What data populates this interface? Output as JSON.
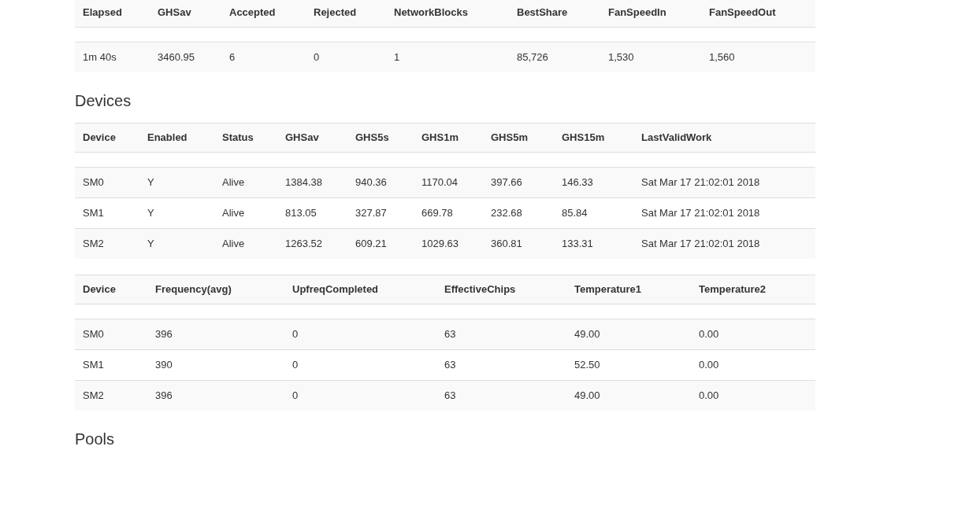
{
  "sections": [
    {
      "table": {
        "columns": [
          "Elapsed",
          "GHSav",
          "Accepted",
          "Rejected",
          "NetworkBlocks",
          "BestShare",
          "FanSpeedIn",
          "FanSpeedOut"
        ],
        "rows": [
          [
            "1m 40s",
            "3460.95",
            "6",
            "0",
            "1",
            "85,726",
            "1,530",
            "1,560"
          ]
        ]
      }
    },
    {
      "heading": "Devices",
      "table": {
        "columns": [
          "Device",
          "Enabled",
          "Status",
          "GHSav",
          "GHS5s",
          "GHS1m",
          "GHS5m",
          "GHS15m",
          "LastValidWork"
        ],
        "rows": [
          [
            "SM0",
            "Y",
            "Alive",
            "1384.38",
            "940.36",
            "1170.04",
            "397.66",
            "146.33",
            "Sat Mar 17 21:02:01 2018"
          ],
          [
            "SM1",
            "Y",
            "Alive",
            "813.05",
            "327.87",
            "669.78",
            "232.68",
            "85.84",
            "Sat Mar 17 21:02:01 2018"
          ],
          [
            "SM2",
            "Y",
            "Alive",
            "1263.52",
            "609.21",
            "1029.63",
            "360.81",
            "133.31",
            "Sat Mar 17 21:02:01 2018"
          ]
        ]
      }
    },
    {
      "table": {
        "columns": [
          "Device",
          "Frequency(avg)",
          "UpfreqCompleted",
          "EffectiveChips",
          "Temperature1",
          "Temperature2"
        ],
        "rows": [
          [
            "SM0",
            "396",
            "0",
            "63",
            "49.00",
            "0.00"
          ],
          [
            "SM1",
            "390",
            "0",
            "63",
            "52.50",
            "0.00"
          ],
          [
            "SM2",
            "396",
            "0",
            "63",
            "49.00",
            "0.00"
          ]
        ]
      }
    },
    {
      "heading": "Pools"
    }
  ]
}
